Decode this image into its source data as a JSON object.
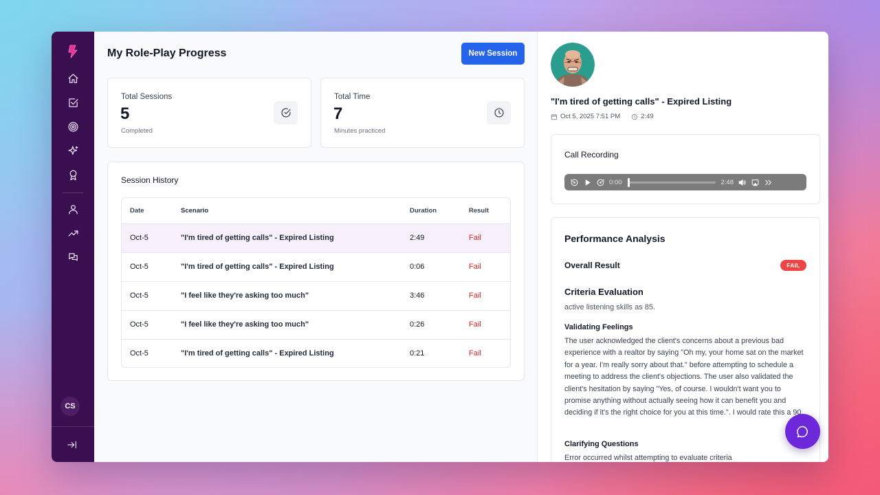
{
  "main": {
    "page_title": "My Role-Play Progress",
    "new_session_label": "New Session",
    "stats": [
      {
        "label": "Total Sessions",
        "value": "5",
        "sub": "Completed",
        "icon": "check-circle-icon"
      },
      {
        "label": "Total Time",
        "value": "7",
        "sub": "Minutes practiced",
        "icon": "clock-icon"
      }
    ],
    "history": {
      "title": "Session History",
      "columns": [
        "Date",
        "Scenario",
        "Duration",
        "Result"
      ],
      "rows": [
        {
          "date": "Oct-5",
          "scenario": "\"I'm tired of getting calls\" - Expired Listing",
          "duration": "2:49",
          "result": "Fail"
        },
        {
          "date": "Oct-5",
          "scenario": "\"I'm tired of getting calls\" - Expired Listing",
          "duration": "0:06",
          "result": "Fail"
        },
        {
          "date": "Oct-5",
          "scenario": "\"I feel like they're asking too much\"",
          "duration": "3:46",
          "result": "Fail"
        },
        {
          "date": "Oct-5",
          "scenario": "\"I feel like they're asking too much\"",
          "duration": "0:26",
          "result": "Fail"
        },
        {
          "date": "Oct-5",
          "scenario": "\"I'm tired of getting calls\" - Expired Listing",
          "duration": "0:21",
          "result": "Fail"
        }
      ]
    }
  },
  "sidebar": {
    "user_initials": "CS",
    "nav_icons": [
      "home-icon",
      "checkbox-icon",
      "target-icon",
      "sparkles-icon",
      "award-icon",
      "user-icon",
      "trending-up-icon",
      "messages-icon"
    ],
    "collapse_icon": "expand-right-icon"
  },
  "detail": {
    "title": "\"I'm tired of getting calls\" - Expired Listing",
    "date": "Oct 5, 2025 7:51 PM",
    "duration": "2:49",
    "recording": {
      "title": "Call Recording",
      "current_time": "0:00",
      "total_time": "2:48",
      "progress": 0
    },
    "performance": {
      "title": "Performance Analysis",
      "overall_label": "Overall Result",
      "overall_badge": "FAIL",
      "criteria_title": "Criteria Evaluation",
      "criteria_sub": "active listening skills as 85.",
      "validating_title": "Validating Feelings",
      "validating_text": "The user acknowledged the client's concerns about a previous bad experience with a realtor by saying \"Oh my, your home sat on the market for a year. I'm really sorry about that.\" before attempting to schedule a meeting to address the client's objections. The user also validated the client's hesitation by saying \"Yes, of course. I wouldn't want you to promise anything without actually seeing how it can benefit you and deciding if it's the right choice for you at this time.\". I would rate this a 90.",
      "clarifying_title": "Clarifying Questions",
      "clarifying_text": "Error occurred whilst attempting to evaluate criteria"
    }
  },
  "colors": {
    "sidebar": "#3a0f4f",
    "primary": "#2563eb",
    "fail": "#dc2626",
    "chat_fab": "#6d28d9"
  }
}
